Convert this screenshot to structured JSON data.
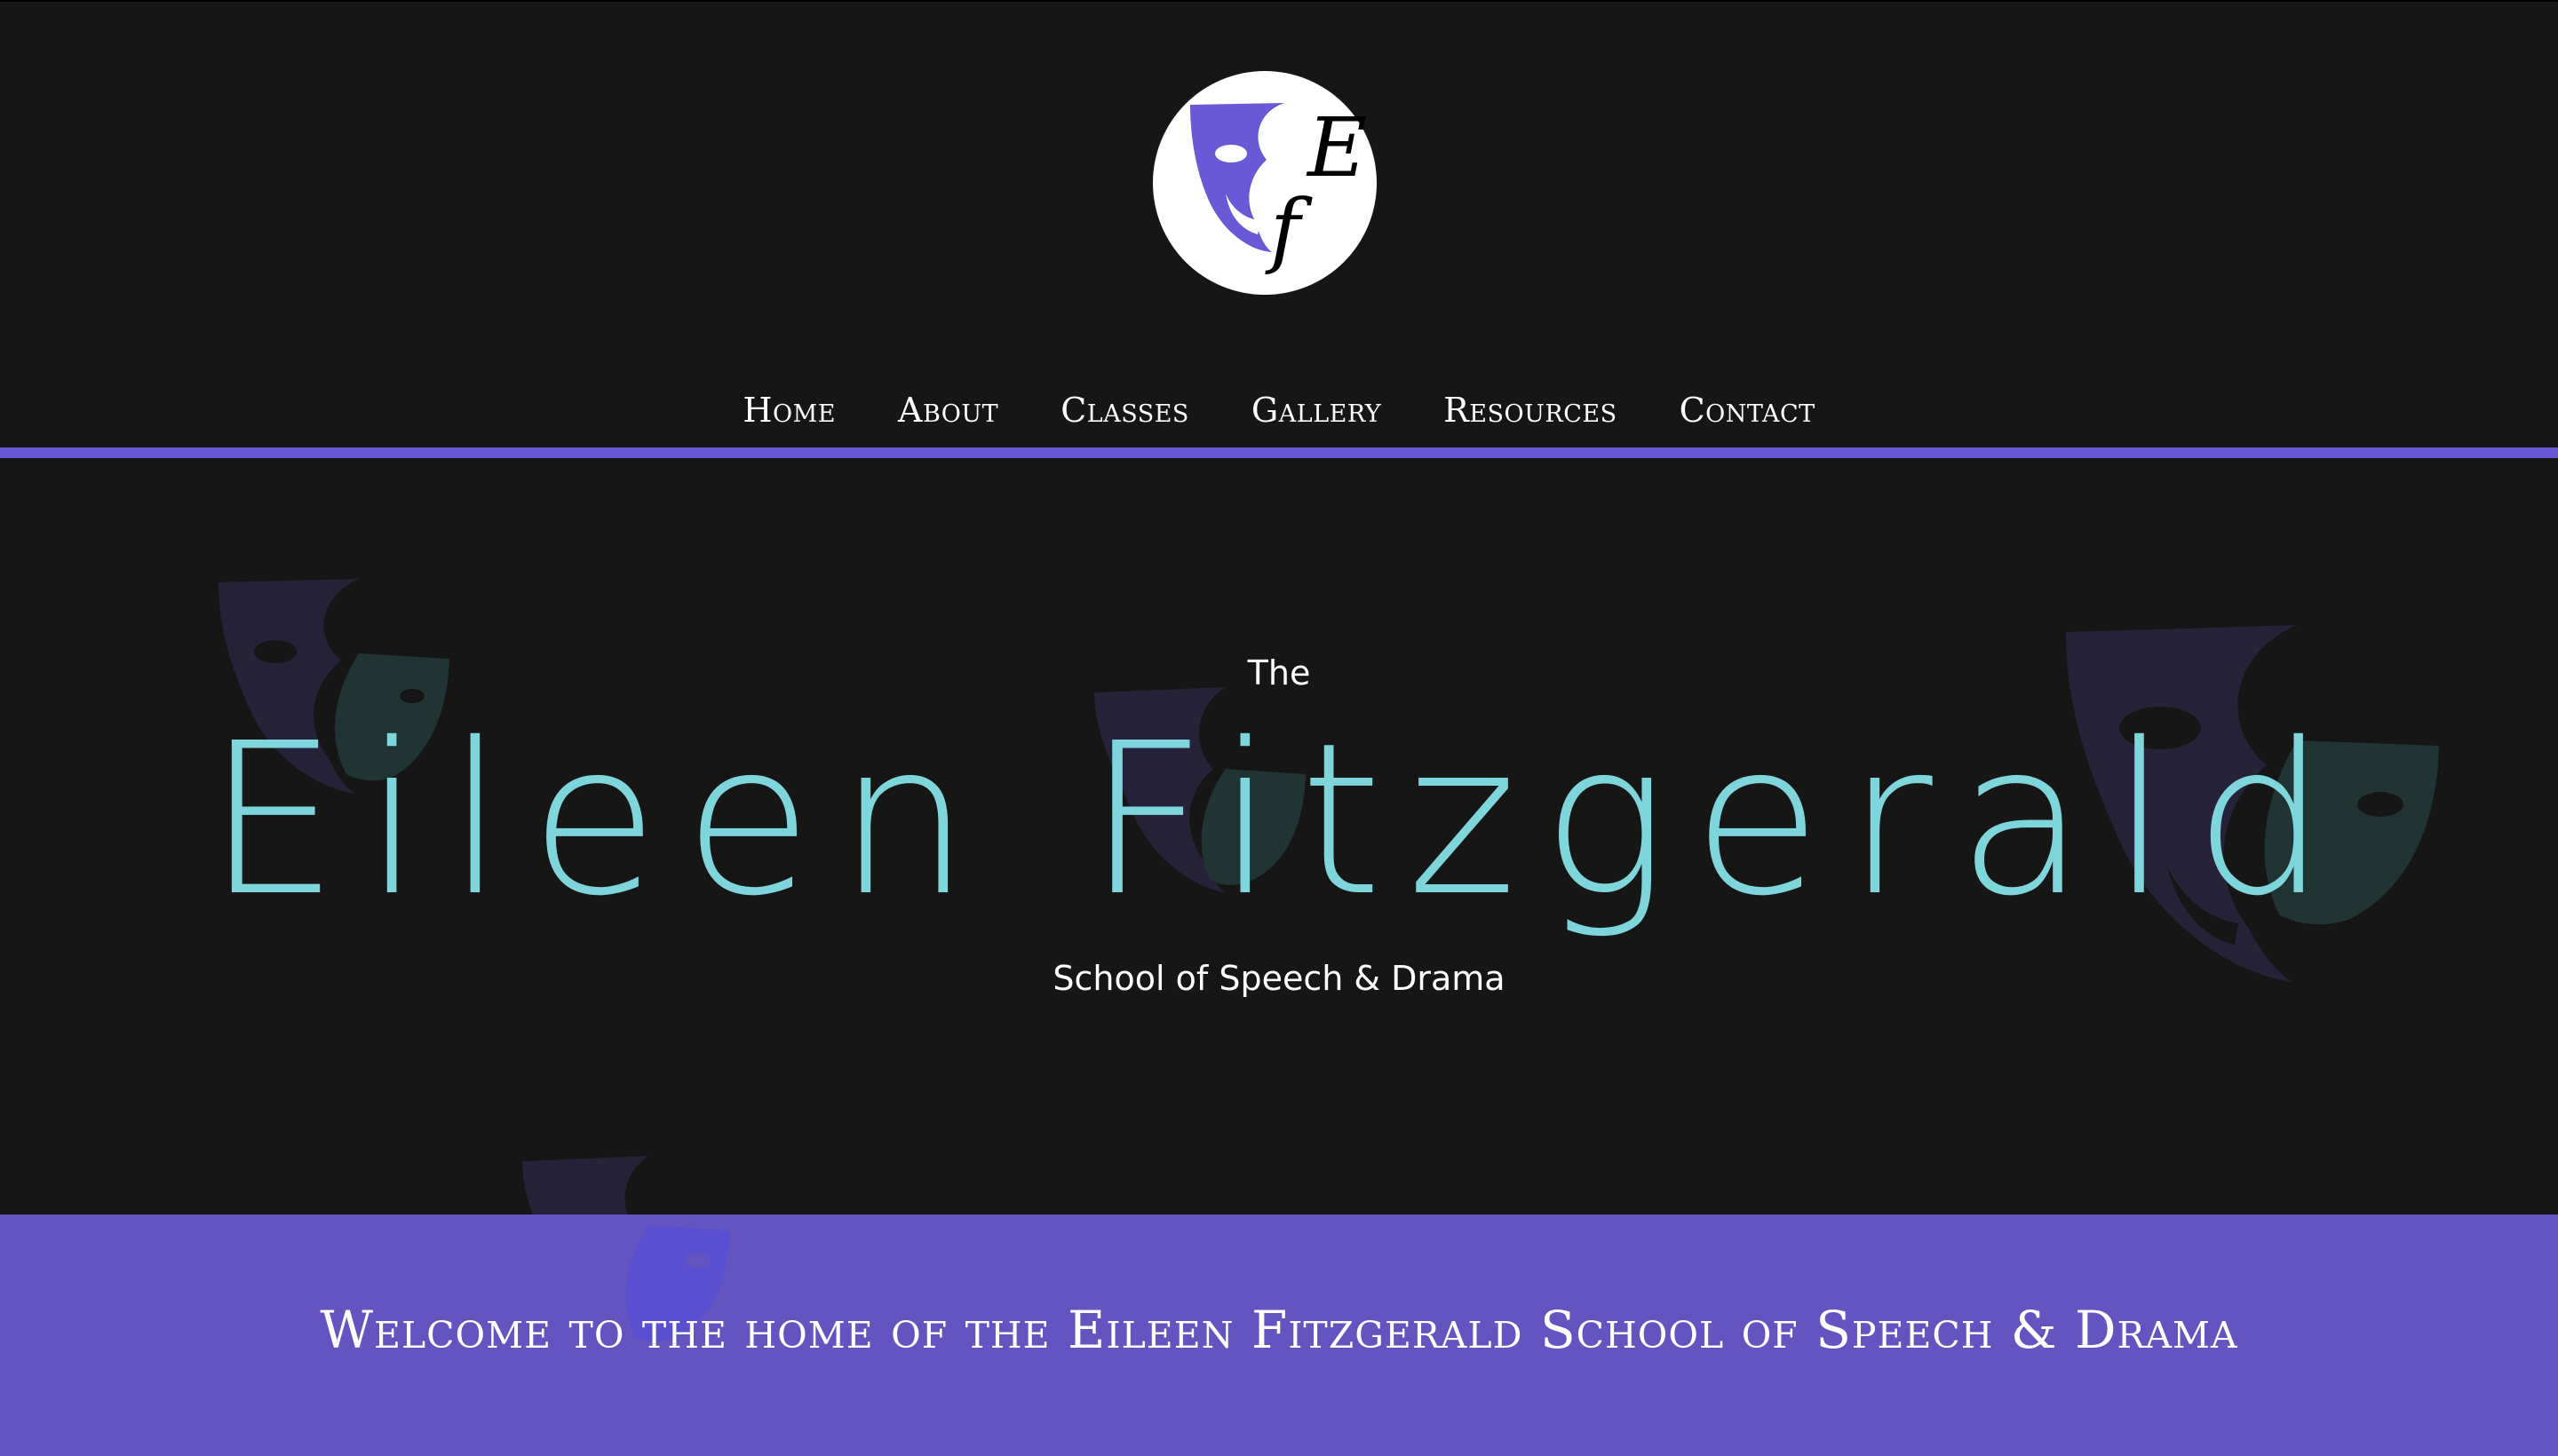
{
  "nav": {
    "items": [
      "Home",
      "About",
      "Classes",
      "Gallery",
      "Resources",
      "Contact"
    ]
  },
  "hero": {
    "pre": "The",
    "title": "Eileen Fitzgerald",
    "subtitle": "School of Speech & Drama"
  },
  "welcome": {
    "text": "Welcome to the home of the Eileen Fitzgerald School of Speech & Drama"
  },
  "colors": {
    "background": "#161616",
    "accent": "#6a59d6",
    "band": "#6354c0",
    "title": "#7ed6dc"
  },
  "icons": {
    "logo": "theatre-mask-logo-icon",
    "background": "theatre-masks-icon"
  }
}
